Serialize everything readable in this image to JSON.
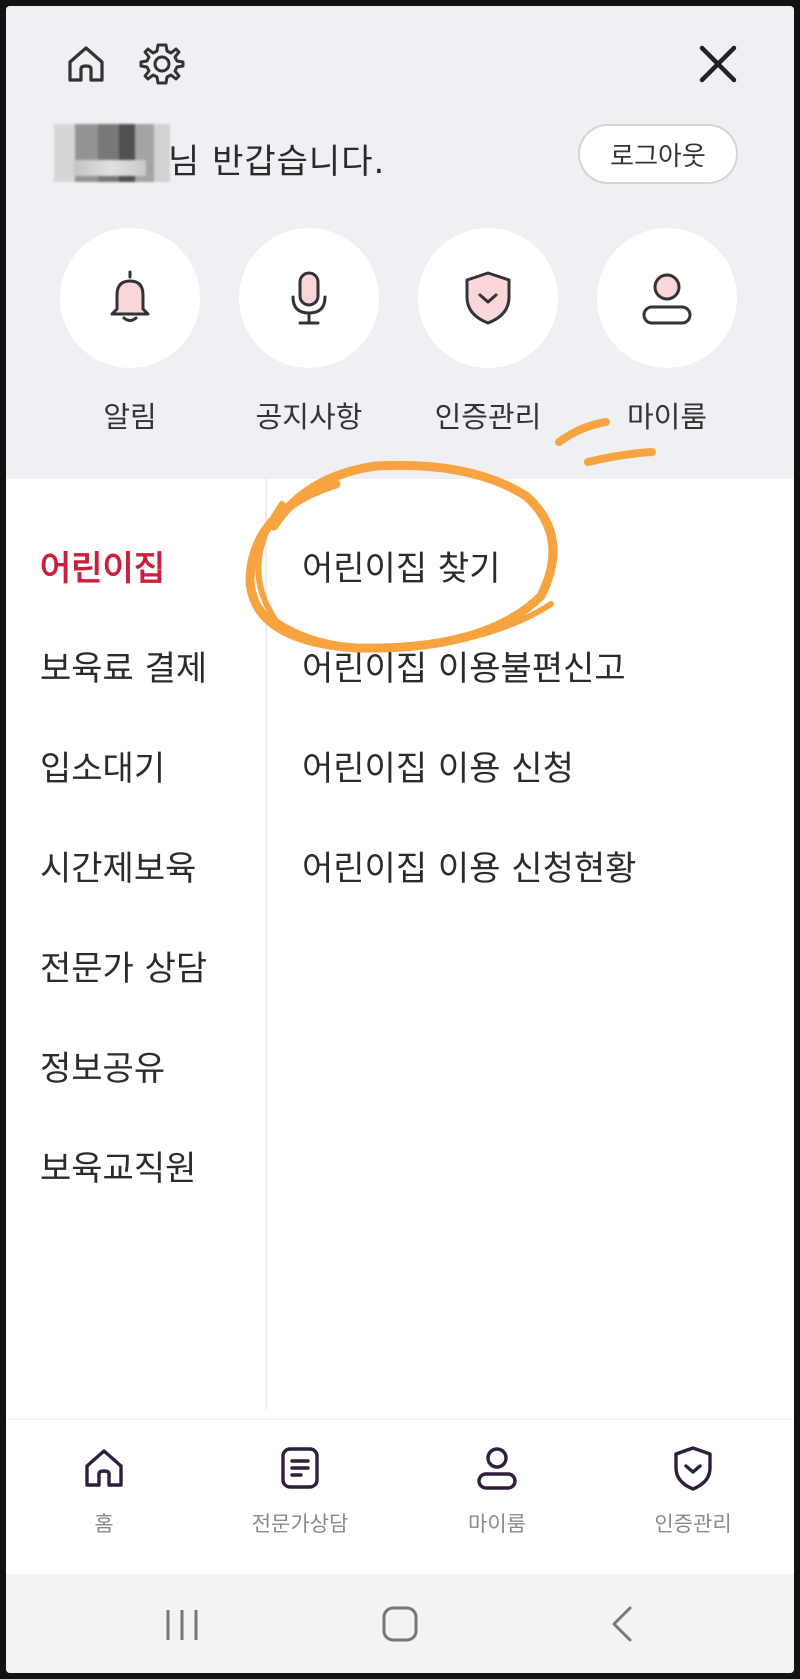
{
  "header": {
    "greeting_suffix": "님 반갑습니다.",
    "logout_label": "로그아웃",
    "quick_links": [
      {
        "label": "알림",
        "icon": "bell-icon"
      },
      {
        "label": "공지사항",
        "icon": "microphone-icon"
      },
      {
        "label": "인증관리",
        "icon": "shield-icon"
      },
      {
        "label": "마이룸",
        "icon": "person-icon"
      }
    ]
  },
  "menu": {
    "categories": [
      {
        "label": "어린이집",
        "active": true
      },
      {
        "label": "보육료 결제"
      },
      {
        "label": "입소대기"
      },
      {
        "label": "시간제보육"
      },
      {
        "label": "전문가 상담"
      },
      {
        "label": "정보공유"
      },
      {
        "label": "보육교직원"
      }
    ],
    "sub_items": [
      {
        "label": "어린이집 찾기"
      },
      {
        "label": "어린이집 이용불편신고"
      },
      {
        "label": "어린이집 이용 신청"
      },
      {
        "label": "어린이집 이용 신청현황"
      }
    ]
  },
  "bottom_nav": [
    {
      "label": "홈",
      "icon": "home-icon"
    },
    {
      "label": "전문가상담",
      "icon": "document-icon"
    },
    {
      "label": "마이룸",
      "icon": "person-icon"
    },
    {
      "label": "인증관리",
      "icon": "shield-icon"
    }
  ],
  "colors": {
    "accent": "#c8203d",
    "header_bg": "#eff0f4",
    "icon_pink": "#fbd6d9",
    "nav_icon": "#2f1e3d",
    "annotation": "#f7a440"
  }
}
